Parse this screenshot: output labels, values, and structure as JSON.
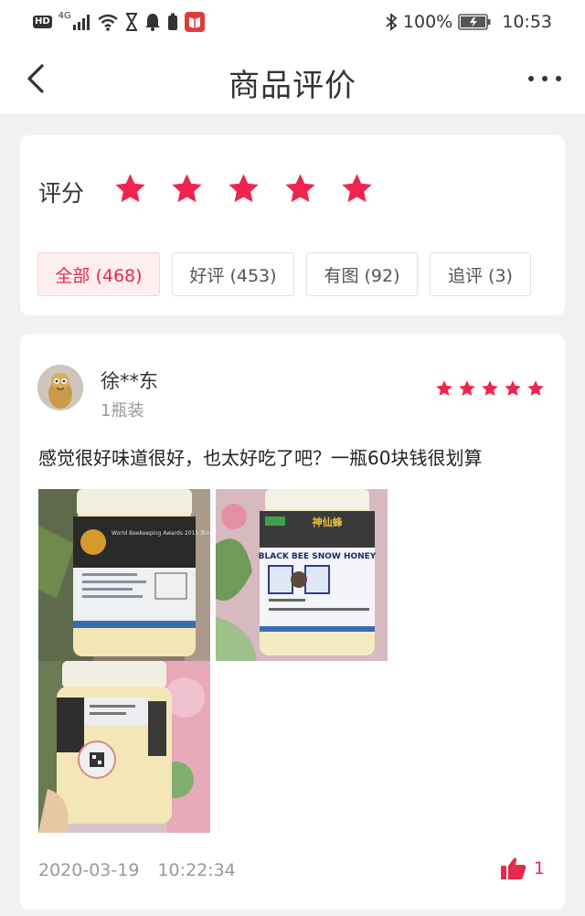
{
  "status_bar": {
    "left_icons": [
      "hd-icon",
      "signal-4g-icon",
      "wifi-icon",
      "hourglass-icon",
      "bell-icon",
      "battery-saver-icon",
      "reader-app-icon"
    ],
    "hd_label": "HD",
    "network_label": "4G",
    "bluetooth_icon": "bluetooth-icon",
    "battery_percent": "100%",
    "time": "10:53"
  },
  "header": {
    "title": "商品评价",
    "back_icon": "chevron-left-icon",
    "more_icon": "more-dots-icon"
  },
  "rating": {
    "label": "评分",
    "stars": 5,
    "star_color": "#f0254f",
    "filters": [
      {
        "label": "全部 (468)",
        "active": true
      },
      {
        "label": "好评 (453)",
        "active": false
      },
      {
        "label": "有图 (92)",
        "active": false
      },
      {
        "label": "追评 (3)",
        "active": false
      }
    ]
  },
  "review": {
    "user_name": "徐**东",
    "variant": "1瓶装",
    "stars": 5,
    "text": "感觉很好味道很好，也太好吃了吧？一瓶60块钱很划算",
    "photos": [
      {
        "jar_label": "World Beekeeping Awards 2015 第44届国际养蜂大会金奖",
        "kind": "black-label-jar"
      },
      {
        "jar_label": "BLACK BEE SNOW HONEY",
        "brand": "神仙蜂",
        "kind": "front-jar"
      },
      {
        "jar_label": "",
        "kind": "back-jar"
      }
    ],
    "date": "2020-03-19",
    "time": "10:22:34",
    "likes": "1",
    "accent_color": "#e8284c"
  }
}
